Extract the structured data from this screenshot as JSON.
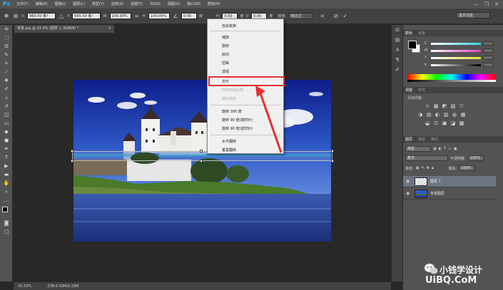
{
  "app": {
    "logo": "Ps",
    "menus": [
      "文件(F)",
      "编辑(E)",
      "图像(I)",
      "图层(L)",
      "类型(Y)",
      "选择(S)",
      "滤镜(T)",
      "3D(D)",
      "视图(V)",
      "窗口(W)",
      "帮助(H)"
    ],
    "window_controls": [
      "—",
      "❐",
      "✕"
    ]
  },
  "options": {
    "x_label": "X:",
    "x_value": "960.00 像!",
    "y_label": "Y:",
    "y_value": "565.50 像!",
    "w_label": "W:",
    "w_value": "100.00%",
    "h_label": "H:",
    "h_value": "100.00%",
    "angle_value": "0.00",
    "angle_unit": "度",
    "hskew_label": "H:",
    "hskew_value": "0.00",
    "hskew_unit": "度",
    "vskew_label": "V:",
    "vskew_value": "0.00",
    "vskew_unit": "度",
    "interp_label": "插值:",
    "interp_value": "两次立",
    "workspace": "基本功能"
  },
  "document": {
    "tab_title": "背景.jpg @ 33.3% (图层 1, RGB/8) *",
    "close": "×"
  },
  "context_menu": {
    "items": [
      {
        "label": "自由变换",
        "disabled": false
      },
      {
        "label": "缩放",
        "disabled": false
      },
      {
        "label": "旋转",
        "disabled": false
      },
      {
        "label": "斜切",
        "disabled": false
      },
      {
        "label": "扭曲",
        "disabled": false
      },
      {
        "label": "透视",
        "disabled": false
      },
      {
        "label": "变形",
        "disabled": false
      },
      {
        "label": "内容识别比例",
        "disabled": true
      },
      {
        "label": "操控变形",
        "disabled": true
      },
      {
        "label": "旋转 180 度",
        "disabled": false
      },
      {
        "label": "旋转 90 度(顺时针)",
        "disabled": false
      },
      {
        "label": "旋转 90 度(逆时针)",
        "disabled": false
      },
      {
        "label": "水平翻转",
        "disabled": false
      },
      {
        "label": "垂直翻转",
        "disabled": false
      }
    ],
    "highlighted": "变形",
    "annotation_color": "#e53030"
  },
  "panels": {
    "color_tabs": [
      "颜色",
      "色板"
    ],
    "color_sliders": [
      {
        "channel": "C",
        "color": "#3ad0e8"
      },
      {
        "channel": "M",
        "color": "#e040c8"
      },
      {
        "channel": "Y",
        "color": "#e8e030"
      },
      {
        "channel": "K",
        "color": "#c8c8c8"
      }
    ],
    "adjust_tabs": [
      "调整",
      "样式"
    ],
    "adjust_hint": "添加调整",
    "adjust_icons": [
      "☼",
      "▦",
      "◩",
      "▨",
      "▽",
      "◑",
      "▤",
      "◐",
      "▥",
      "◍",
      "▦",
      "◒",
      "⊡",
      "▣",
      "◪",
      "▩"
    ],
    "layer_tabs": [
      "图层",
      "通道",
      "路径"
    ],
    "kind_select": "类型",
    "blend_mode": "柔光",
    "opacity_label": "不透明度:",
    "opacity_value": "100%",
    "lock_label": "锁定:",
    "fill_label": "填充:",
    "fill_value": "100%",
    "layers": [
      {
        "name": "图层 1",
        "selected": true
      },
      {
        "name": "背景图层",
        "selected": false
      }
    ]
  },
  "status": {
    "zoom": "33.33%",
    "doc_size": "文档:6.59M/9.28M"
  },
  "watermark": {
    "name": "小钱学设计",
    "site": "UiBQ.CoM"
  },
  "colors": {
    "photoshop_blue": "#31a8ff",
    "panel_bg": "#535353",
    "canvas_bg": "#282828",
    "highlight_red": "#e53030"
  }
}
